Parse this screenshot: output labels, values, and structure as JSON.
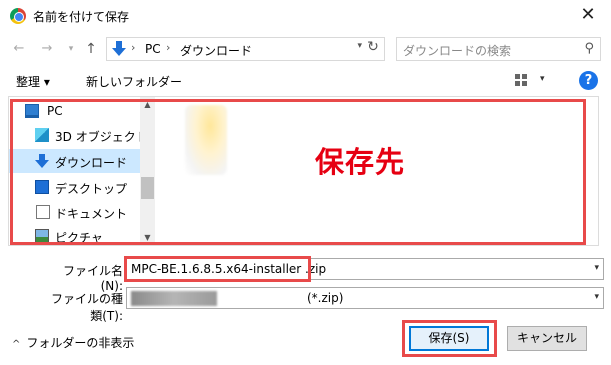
{
  "window": {
    "title": "名前を付けて保存",
    "close_glyph": "✕"
  },
  "nav": {
    "back_glyph": "←",
    "forward_glyph": "→",
    "recent_glyph": "▾",
    "up_glyph": "↑",
    "address": {
      "separator": "›",
      "segments": [
        "PC",
        "ダウンロード"
      ],
      "dropdown_glyph": "▾",
      "refresh_glyph": "↻"
    },
    "search": {
      "placeholder": "ダウンロードの検索",
      "icon_glyph": "⚲"
    }
  },
  "toolbar": {
    "organize_label": "整理 ▾",
    "new_folder_label": "新しいフォルダー",
    "view_dropdown_glyph": "▾",
    "help_glyph": "?"
  },
  "sidebar": {
    "items": [
      {
        "label": "PC",
        "icon": "pc-icon"
      },
      {
        "label": "3D オブジェクト",
        "icon": "3d-objects-icon"
      },
      {
        "label": "ダウンロード",
        "icon": "download-icon",
        "selected": true
      },
      {
        "label": "デスクトップ",
        "icon": "desktop-icon"
      },
      {
        "label": "ドキュメント",
        "icon": "documents-icon"
      },
      {
        "label": "ピクチャ",
        "icon": "pictures-icon"
      }
    ],
    "scroll_up_glyph": "▲",
    "scroll_down_glyph": "▼"
  },
  "annotation": {
    "destination_label": "保存先",
    "highlight_color": "#e84a4a",
    "text_color": "#e60012"
  },
  "form": {
    "filename_label": "ファイル名(N):",
    "filename_value": "MPC-BE.1.6.8.5.x64-installer .zip",
    "filetype_label": "ファイルの種類(T):",
    "filetype_value": "(*.zip)",
    "dropdown_glyph": "▾"
  },
  "footer": {
    "hide_folders_label": "フォルダーの非表示",
    "hide_folders_glyph": "^",
    "save_label": "保存(S)",
    "cancel_label": "キャンセル"
  }
}
